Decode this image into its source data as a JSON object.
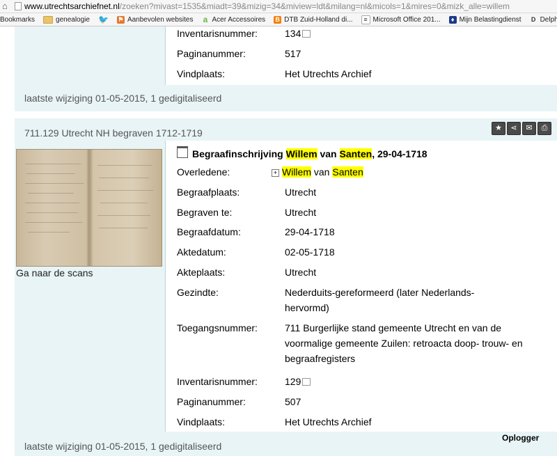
{
  "browser": {
    "url_host": "www.utrechtsarchiefnet.nl",
    "url_rest": "/zoeken?mivast=1535&miadt=39&mizig=34&miview=ldt&milang=nl&micols=1&mires=0&mizk_alle=willem"
  },
  "bookmarks": [
    {
      "label": "Bookmarks",
      "icon": "none"
    },
    {
      "label": "genealogie",
      "icon": "folder-icon"
    },
    {
      "label": "",
      "icon": "twitter-icon"
    },
    {
      "label": "Aanbevolen websites",
      "icon": "bookmark-icon"
    },
    {
      "label": "Acer Accessoires",
      "icon": "acer-icon"
    },
    {
      "label": "DTB Zuid-Holland di...",
      "icon": "blogger-icon"
    },
    {
      "label": "Microsoft Office 201...",
      "icon": "office-icon"
    },
    {
      "label": "Mijn Belastingdienst",
      "icon": "belasting-icon"
    },
    {
      "label": "Delpher - Boeken",
      "icon": "delpher-icon"
    }
  ],
  "record1": {
    "fields": [
      {
        "label": "Inventarisnummer:",
        "value": "134",
        "link": true
      },
      {
        "label": "Paginanummer:",
        "value": "517",
        "link": false
      },
      {
        "label": "Vindplaats:",
        "value": "Het Utrechts Archief",
        "link": false
      }
    ],
    "footer": "laatste wijziging 01-05-2015,  1 gedigitaliseerd"
  },
  "record2": {
    "header": "711.129 Utrecht NH begraven 1712-1719",
    "tools": [
      "bookmark-icon",
      "share-icon",
      "mail-icon",
      "print-icon"
    ],
    "scan_link": "Ga naar de scans",
    "title_prefix": "Begraafinschrijving ",
    "title_first": "Willem",
    "title_mid": " van ",
    "title_last": "Santen",
    "title_suffix": ", 29-04-1718",
    "deceased_label": "Overledene:",
    "deceased_first": "Willem",
    "deceased_mid": " van ",
    "deceased_last": "Santen",
    "fields": [
      {
        "label": "Begraafplaats:",
        "value": "Utrecht"
      },
      {
        "label": "Begraven te:",
        "value": "Utrecht"
      },
      {
        "label": "Begraafdatum:",
        "value": "29-04-1718"
      },
      {
        "label": "Aktedatum:",
        "value": "02-05-1718"
      },
      {
        "label": "Akteplaats:",
        "value": "Utrecht"
      },
      {
        "label": "Gezindte:",
        "value": "Nederduits-gereformeerd (later Nederlands-hervormd)"
      },
      {
        "label": "Toegangsnummer:",
        "value": "711 Burgerlijke stand gemeente Utrecht en van de voormalige gemeente Zuilen: retroacta doop- trouw- en begraafregisters"
      },
      {
        "label": "Inventarisnummer:",
        "value": "129"
      },
      {
        "label": "Paginanummer:",
        "value": "507"
      },
      {
        "label": "Vindplaats:",
        "value": "Het Utrechts Archief"
      }
    ],
    "footer": "laatste wijziging 01-05-2015,  1 gedigitaliseerd"
  },
  "watermark": "Oplogger"
}
